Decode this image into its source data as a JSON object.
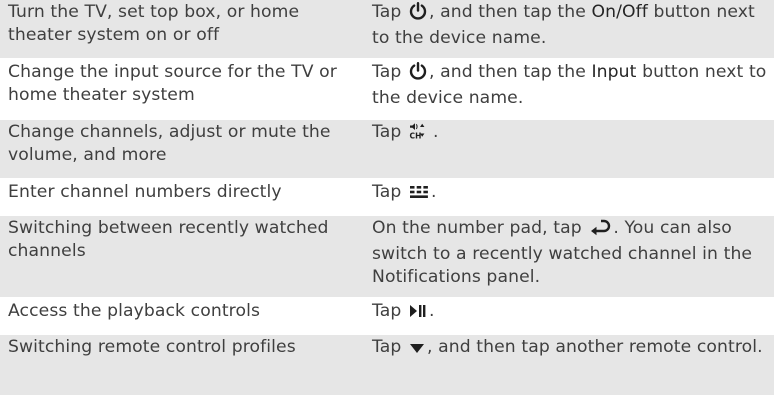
{
  "rows": [
    {
      "task": "Turn the TV, set top box, or home theater system on or off",
      "inst_pre": "Tap ",
      "inst_icon": "power-icon",
      "inst_mid": ", and then tap the ",
      "inst_hl": "On/Off",
      "inst_post": " button next to the device name."
    },
    {
      "task": "Change the input source for the TV or home theater system",
      "inst_pre": "Tap ",
      "inst_icon": "power-icon",
      "inst_mid": ", and then tap the ",
      "inst_hl": "Input",
      "inst_post": " button next to the device name."
    },
    {
      "task": "Change channels, adjust or mute the volume, and more",
      "inst_pre": "Tap ",
      "inst_icon": "volume-channel-icon",
      "inst_post": "."
    },
    {
      "task": "Enter channel numbers directly",
      "inst_pre": "Tap ",
      "inst_icon": "number-pad-icon",
      "inst_post": "."
    },
    {
      "task": "Switching between recently watched channels",
      "inst_pre": "On the number pad, tap ",
      "inst_icon": "return-arrow-icon",
      "inst_post": ". You can also switch to a recently watched channel in the Notifications panel."
    },
    {
      "task": "Access the playback controls",
      "inst_pre": "Tap ",
      "inst_icon": "play-pause-icon",
      "inst_post": "."
    },
    {
      "task": "Switching remote control profiles",
      "inst_pre": "Tap ",
      "inst_icon": "dropdown-triangle-icon",
      "inst_post": ", and then tap another remote control."
    }
  ]
}
